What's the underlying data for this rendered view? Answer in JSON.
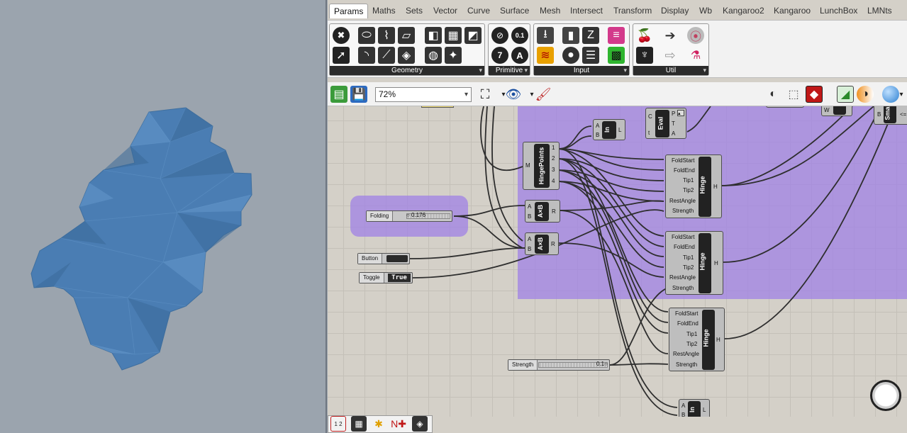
{
  "tabs": [
    "Params",
    "Maths",
    "Sets",
    "Vector",
    "Curve",
    "Surface",
    "Mesh",
    "Intersect",
    "Transform",
    "Display",
    "Wb",
    "Kangaroo2",
    "Kangaroo",
    "LunchBox",
    "LMNts"
  ],
  "panels": {
    "geometry": "Geometry",
    "primitive": "Primitive",
    "input": "Input",
    "util": "Util"
  },
  "toolbar": {
    "zoom": "72%"
  },
  "components": {
    "hingepoints": {
      "name": "HingePoints",
      "in": "M",
      "outs": [
        "1",
        "2",
        "3",
        "4"
      ]
    },
    "ln_top": {
      "name": "ln",
      "ins": [
        "A",
        "B"
      ],
      "out": "L"
    },
    "eval": {
      "name": "Eval",
      "ins": [
        "C",
        "t"
      ],
      "outs": [
        "P",
        "T",
        "A"
      ]
    },
    "mult1": {
      "name": "A×B",
      "ins": [
        "A",
        "B"
      ],
      "out": "R"
    },
    "mult2": {
      "name": "A×B",
      "ins": [
        "A",
        "B"
      ],
      "out": "R"
    },
    "hinge_ports": [
      "FoldStart",
      "FoldEnd",
      "Tip1",
      "Tip2",
      "RestAngle",
      "Strength"
    ],
    "hinge1": {
      "name": "Hinge",
      "out": "H"
    },
    "hinge2": {
      "name": "Hinge",
      "out": "H"
    },
    "hinge3": {
      "name": "Hinge",
      "out": "H"
    },
    "ln_bottom": {
      "name": "ln",
      "ins": [
        "A",
        "B"
      ],
      "out": "L"
    },
    "partial_w": "W",
    "partial_sm": {
      "name": "Sma",
      "in": "B",
      "out": "<="
    }
  },
  "sliders": {
    "folding": {
      "name": "Folding",
      "value": "0.176"
    },
    "strength": {
      "name": "Strength",
      "value": "0.1"
    }
  },
  "params": {
    "button": {
      "name": "Button"
    },
    "toggle": {
      "name": "Toggle",
      "value": "True"
    }
  },
  "bottom_icons": [
    "1 2"
  ],
  "colors": {
    "mesh": "#4a7db3",
    "group": "#a082e6",
    "canvas": "#d4d0c8"
  }
}
